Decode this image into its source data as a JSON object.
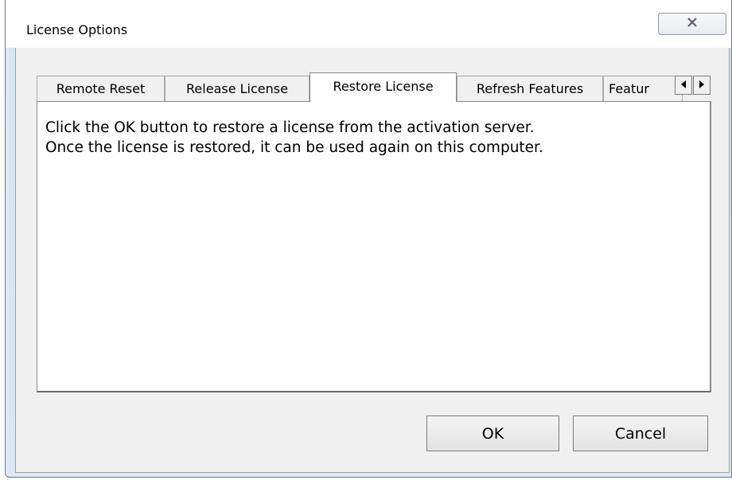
{
  "window": {
    "title": "License Options"
  },
  "titlebar": {
    "close_icon": "close-icon"
  },
  "tabs": [
    {
      "label": "Remote Reset",
      "active": false
    },
    {
      "label": "Release License",
      "active": false
    },
    {
      "label": "Restore License",
      "active": true
    },
    {
      "label": "Refresh Features",
      "active": false
    },
    {
      "label": "Featur",
      "active": false
    }
  ],
  "tab_scroll": {
    "left_icon": "arrow-left-icon",
    "right_icon": "arrow-right-icon"
  },
  "panel": {
    "text": "Click the OK button to restore a license from the activation server.\nOnce the license is restored, it can be used again on this computer."
  },
  "buttons": {
    "ok_label": "OK",
    "cancel_label": "Cancel"
  }
}
